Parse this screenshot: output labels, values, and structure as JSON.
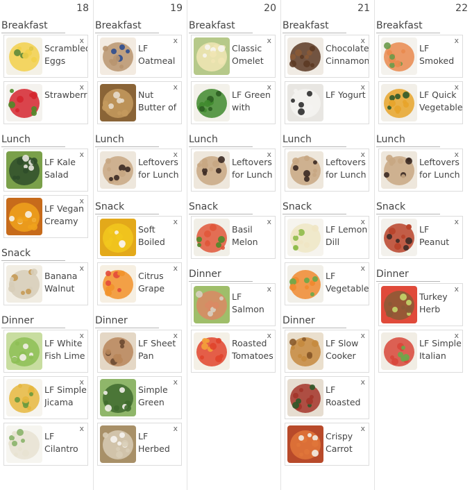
{
  "days": [
    {
      "num": "18",
      "sections": [
        {
          "label": "Breakfast",
          "items": [
            {
              "title": [
                "Scrambled",
                "Eggs"
              ],
              "img": "eggs"
            },
            {
              "title": [
                "Strawberri",
                ""
              ],
              "img": "strawberries"
            }
          ]
        },
        {
          "label": "Lunch",
          "items": [
            {
              "title": [
                "LF Kale",
                "Salad"
              ],
              "img": "kale"
            },
            {
              "title": [
                "LF Vegan",
                "Creamy"
              ],
              "img": "soup"
            }
          ]
        },
        {
          "label": "Snack",
          "items": [
            {
              "title": [
                "Banana",
                "Walnut"
              ],
              "img": "oats"
            }
          ]
        },
        {
          "label": "Dinner",
          "items": [
            {
              "title": [
                "LF White",
                "Fish Lime"
              ],
              "img": "lettuce"
            },
            {
              "title": [
                "LF Simple",
                "Jicama"
              ],
              "img": "slaw"
            },
            {
              "title": [
                "LF",
                "Cilantro"
              ],
              "img": "rice"
            }
          ]
        }
      ]
    },
    {
      "num": "19",
      "sections": [
        {
          "label": "Breakfast",
          "items": [
            {
              "title": [
                "LF",
                "Oatmeal"
              ],
              "img": "oatmeal"
            },
            {
              "title": [
                "Nut",
                "Butter of"
              ],
              "img": "nutbutter"
            }
          ]
        },
        {
          "label": "Lunch",
          "items": [
            {
              "title": [
                "Leftovers",
                "for Lunch"
              ],
              "img": "bag"
            }
          ]
        },
        {
          "label": "Snack",
          "items": [
            {
              "title": [
                "Soft",
                "Boiled"
              ],
              "img": "egg"
            },
            {
              "title": [
                "Citrus",
                "Grape"
              ],
              "img": "citrus"
            }
          ]
        },
        {
          "label": "Dinner",
          "items": [
            {
              "title": [
                "LF Sheet",
                "Pan"
              ],
              "img": "chicken"
            },
            {
              "title": [
                "Simple",
                "Green"
              ],
              "img": "greensalad"
            },
            {
              "title": [
                "LF",
                "Herbed"
              ],
              "img": "grain"
            }
          ]
        }
      ]
    },
    {
      "num": "20",
      "sections": [
        {
          "label": "Breakfast",
          "items": [
            {
              "title": [
                "Classic",
                "Omelet"
              ],
              "img": "omelet"
            },
            {
              "title": [
                "LF Green",
                "with"
              ],
              "img": "pesto"
            }
          ]
        },
        {
          "label": "Lunch",
          "items": [
            {
              "title": [
                "Leftovers",
                "for Lunch"
              ],
              "img": "bag"
            }
          ]
        },
        {
          "label": "Snack",
          "items": [
            {
              "title": [
                "Basil",
                "Melon"
              ],
              "img": "melon"
            }
          ]
        },
        {
          "label": "Dinner",
          "items": [
            {
              "title": [
                "LF",
                "Salmon"
              ],
              "img": "salmon"
            },
            {
              "title": [
                "Roasted",
                "Tomatoes"
              ],
              "img": "tomatoes"
            }
          ]
        }
      ]
    },
    {
      "num": "21",
      "sections": [
        {
          "label": "Breakfast",
          "items": [
            {
              "title": [
                "Chocolate",
                "Cinnamon"
              ],
              "img": "muffins"
            },
            {
              "title": [
                "LF Yogurt",
                ""
              ],
              "img": "yogurt"
            }
          ]
        },
        {
          "label": "Lunch",
          "items": [
            {
              "title": [
                "Leftovers",
                "for Lunch"
              ],
              "img": "bag"
            }
          ]
        },
        {
          "label": "Snack",
          "items": [
            {
              "title": [
                "LF Lemon",
                "Dill"
              ],
              "img": "dip"
            },
            {
              "title": [
                "LF",
                "Vegetable"
              ],
              "img": "veggies"
            }
          ]
        },
        {
          "label": "Dinner",
          "items": [
            {
              "title": [
                "LF Slow",
                "Cooker"
              ],
              "img": "stew"
            },
            {
              "title": [
                "LF",
                "Roasted"
              ],
              "img": "roasted"
            },
            {
              "title": [
                "Crispy",
                "Carrot"
              ],
              "img": "carrot"
            }
          ]
        }
      ]
    },
    {
      "num": "22",
      "sections": [
        {
          "label": "Breakfast",
          "items": [
            {
              "title": [
                "LF",
                "Smoked"
              ],
              "img": "smoked"
            },
            {
              "title": [
                "LF Quick",
                "Vegetable"
              ],
              "img": "quickveg"
            }
          ]
        },
        {
          "label": "Lunch",
          "items": [
            {
              "title": [
                "Leftovers",
                "for Lunch"
              ],
              "img": "bag"
            }
          ]
        },
        {
          "label": "Snack",
          "items": [
            {
              "title": [
                "LF",
                "Peanut"
              ],
              "img": "peanut"
            }
          ]
        },
        {
          "label": "Dinner",
          "items": [
            {
              "title": [
                "Turkey",
                "Herb"
              ],
              "img": "burger"
            },
            {
              "title": [
                "LF Simple",
                "Italian"
              ],
              "img": "italian"
            }
          ]
        }
      ]
    }
  ],
  "remove_label": "x",
  "icons": {
    "thumbnail": "food-photo-icon",
    "remove": "close-icon"
  },
  "thumb_colors": {
    "eggs": [
      "#f2d04a",
      "#5f8a3a",
      "#f4f1e6"
    ],
    "strawberries": [
      "#d5262f",
      "#4f8a2a",
      "#f4f2ee"
    ],
    "kale": [
      "#2f4d2a",
      "#e8e6df",
      "#7aa04a"
    ],
    "soup": [
      "#f0a21c",
      "#f7f2e5",
      "#c76b1b"
    ],
    "oats": [
      "#d7cdb8",
      "#c59a55",
      "#f1ede3"
    ],
    "lettuce": [
      "#8dbf55",
      "#f3f0e8",
      "#c8dda0"
    ],
    "slaw": [
      "#e6b73e",
      "#6a9a3e",
      "#f6f4ee"
    ],
    "rice": [
      "#e8e2d2",
      "#8ab36a",
      "#f6f5f0"
    ],
    "oatmeal": [
      "#b8956f",
      "#2e4d8f",
      "#f3ebe1"
    ],
    "nutbutter": [
      "#c49a5e",
      "#e7ddcd",
      "#8a6437"
    ],
    "bag": [
      "#c8a783",
      "#3b2a23",
      "#eee7dc"
    ],
    "egg": [
      "#f2c81e",
      "#f9f2e4",
      "#e3a91a"
    ],
    "citrus": [
      "#f2922a",
      "#e34a3a",
      "#f6efe2"
    ],
    "chicken": [
      "#b8865a",
      "#6b4a32",
      "#e4d7c5"
    ],
    "greensalad": [
      "#3f6b2e",
      "#f2f0ea",
      "#8fb66a"
    ],
    "grain": [
      "#d8cdb6",
      "#f5f3ee",
      "#a89068"
    ],
    "omelet": [
      "#f1e6b4",
      "#f7f5ef",
      "#b6c98a"
    ],
    "pesto": [
      "#3f8a2e",
      "#2c5e22",
      "#f3f1ea"
    ],
    "melon": [
      "#e0573a",
      "#4f8a2a",
      "#f1efe7"
    ],
    "salmon": [
      "#d98a64",
      "#d8d0c2",
      "#9fbe6a"
    ],
    "tomatoes": [
      "#e0442b",
      "#f3a23a",
      "#f4f0e6"
    ],
    "muffins": [
      "#5c3a24",
      "#8a5a36",
      "#f0ebe4"
    ],
    "yogurt": [
      "#f4f3f1",
      "#2d2d2d",
      "#e8e6e2"
    ],
    "dip": [
      "#efe6c4",
      "#8fbb4a",
      "#f6f4ee"
    ],
    "veggies": [
      "#f08a30",
      "#6aa84a",
      "#f1efe8"
    ],
    "stew": [
      "#c58a3e",
      "#8a5a2a",
      "#eadfcd"
    ],
    "roasted": [
      "#a3352a",
      "#2e5a2a",
      "#e6ddd0"
    ],
    "carrot": [
      "#e0753a",
      "#f1ede6",
      "#b84a2a"
    ],
    "smoked": [
      "#e98a4e",
      "#6a9a4a",
      "#f4f2ed"
    ],
    "quickveg": [
      "#e8a42a",
      "#2f5a2a",
      "#f2efe8"
    ],
    "peanut": [
      "#b8432a",
      "#3d2a26",
      "#f3f1ec"
    ],
    "burger": [
      "#8a5a36",
      "#c4d66a",
      "#e04a3a"
    ],
    "italian": [
      "#d8463a",
      "#6aa84a",
      "#f1ede4"
    ]
  }
}
